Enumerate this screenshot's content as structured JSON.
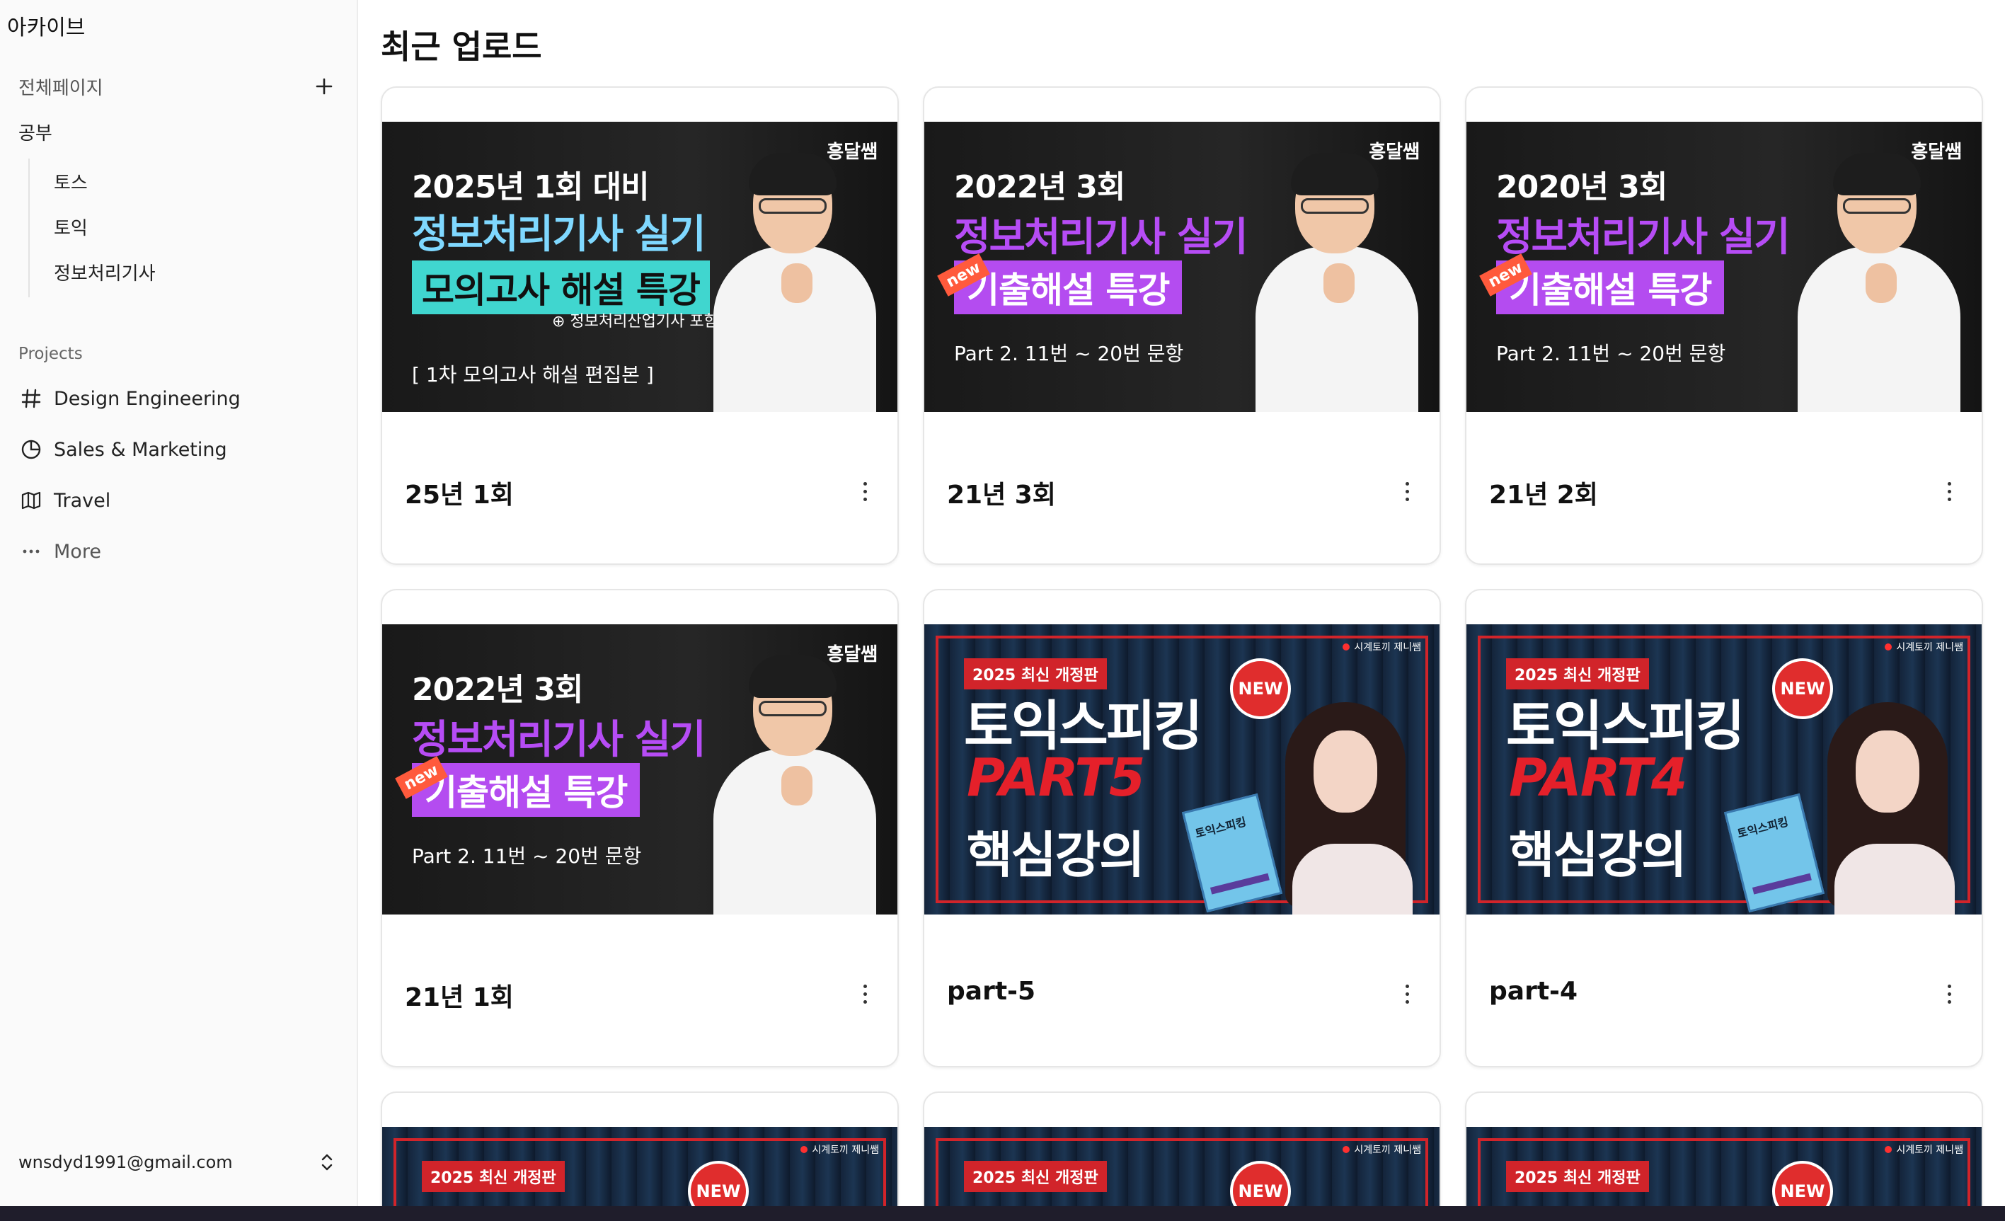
{
  "sidebar": {
    "app_title": "아카이브",
    "all_pages": "전체페이지",
    "study_group": "공부",
    "study_items": [
      "토스",
      "토익",
      "정보처리기사"
    ],
    "projects_label": "Projects",
    "projects": [
      {
        "label": "Design Engineering",
        "icon": "hash-icon"
      },
      {
        "label": "Sales & Marketing",
        "icon": "pie-chart-icon"
      },
      {
        "label": "Travel",
        "icon": "map-icon"
      },
      {
        "label": "More",
        "icon": "ellipsis-icon"
      }
    ],
    "user_email": "wnsdyd1991@gmail.com"
  },
  "main": {
    "title": "최근 업로드",
    "cards": [
      {
        "title": "25년 1회",
        "thumb": {
          "brand": "흥달쌤",
          "line1": "2025년 1회 대비",
          "line2": "정보처리기사 실기",
          "line3": "모의고사 해설 특강",
          "line35": "⊕ 정보처리산업기사 포함",
          "line4": "[ 1차 모의고사 해설 편집본 ]"
        }
      },
      {
        "title": "21년 3회",
        "thumb": {
          "brand": "흥달쌤",
          "line1": "2022년 3회",
          "line2": "정보처리기사 실기",
          "line3": "기출해설 특강",
          "new": "new",
          "line4": "Part 2. 11번 ~ 20번 문항"
        }
      },
      {
        "title": "21년 2회",
        "thumb": {
          "brand": "흥달쌤",
          "line1": "2020년 3회",
          "line2": "정보처리기사 실기",
          "line3": "기출해설 특강",
          "new": "new",
          "line4": "Part 2. 11번 ~ 20번 문항"
        }
      },
      {
        "title": "21년 1회",
        "thumb": {
          "brand": "흥달쌤",
          "line1": "2022년 3회",
          "line2": "정보처리기사 실기",
          "line3": "기출해설 특강",
          "new": "new",
          "line4": "Part 2. 11번 ~ 20번 문항"
        }
      },
      {
        "title": "part-5",
        "thumb": {
          "rec": "시계토끼 제니쌤",
          "badge": "2025 최신 개정판",
          "line1": "토익스피킹",
          "line2": "PART5",
          "line3": "핵심강의",
          "new": "NEW",
          "book": "토익스피킹"
        }
      },
      {
        "title": "part-4",
        "thumb": {
          "rec": "시계토끼 제니쌤",
          "badge": "2025 최신 개정판",
          "line1": "토익스피킹",
          "line2": "PART4",
          "line3": "핵심강의",
          "new": "NEW",
          "book": "토익스피킹"
        }
      }
    ],
    "partial_cards": [
      {
        "rec": "시계토끼 제니쌤",
        "badge": "2025 최신 개정판",
        "new": "NEW"
      },
      {
        "rec": "시계토끼 제니쌤",
        "badge": "2025 최신 개정판",
        "new": "NEW"
      },
      {
        "rec": "시계토끼 제니쌤",
        "badge": "2025 최신 개정판",
        "new": "NEW"
      }
    ]
  }
}
